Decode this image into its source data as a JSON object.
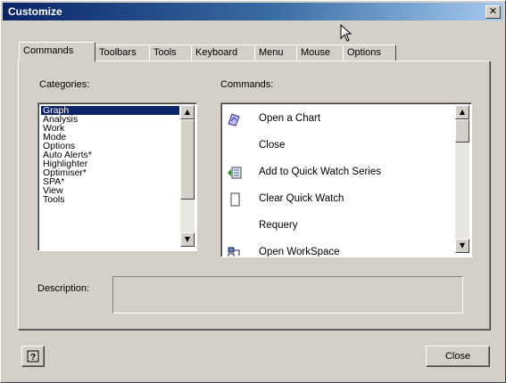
{
  "window": {
    "title": "Customize",
    "close_glyph": "✕"
  },
  "tabs": [
    {
      "label": "Commands",
      "active": true
    },
    {
      "label": "Toolbars",
      "active": false
    },
    {
      "label": "Tools",
      "active": false
    },
    {
      "label": "Keyboard",
      "active": false
    },
    {
      "label": "Menu",
      "active": false
    },
    {
      "label": "Mouse",
      "active": false
    },
    {
      "label": "Options",
      "active": false
    }
  ],
  "categories": {
    "label": "Categories:",
    "selected": "Graph",
    "items": [
      "Graph",
      "Analysis",
      "Work",
      "Mode",
      "Options",
      "Auto Alerts*",
      "Highlighter",
      "Optimiser*",
      "SPA*",
      "View",
      "Tools"
    ]
  },
  "commands": {
    "label": "Commands:",
    "items": [
      {
        "label": "Open a Chart",
        "icon": "open-chart-icon"
      },
      {
        "label": "Close",
        "icon": ""
      },
      {
        "label": "Add to Quick Watch Series",
        "icon": "quick-watch-add-icon"
      },
      {
        "label": "Clear Quick Watch",
        "icon": "clear-watch-icon"
      },
      {
        "label": "Requery",
        "icon": ""
      },
      {
        "label": "Open WorkSpace",
        "icon": "workspace-icon"
      }
    ]
  },
  "description": {
    "label": "Description:",
    "value": ""
  },
  "buttons": {
    "help_icon": "help-icon",
    "close_label": "Close"
  },
  "colors": {
    "titlebar_start": "#0a246a",
    "titlebar_end": "#a6caf0",
    "selection": "#0a246a",
    "face": "#d4d0c8"
  }
}
